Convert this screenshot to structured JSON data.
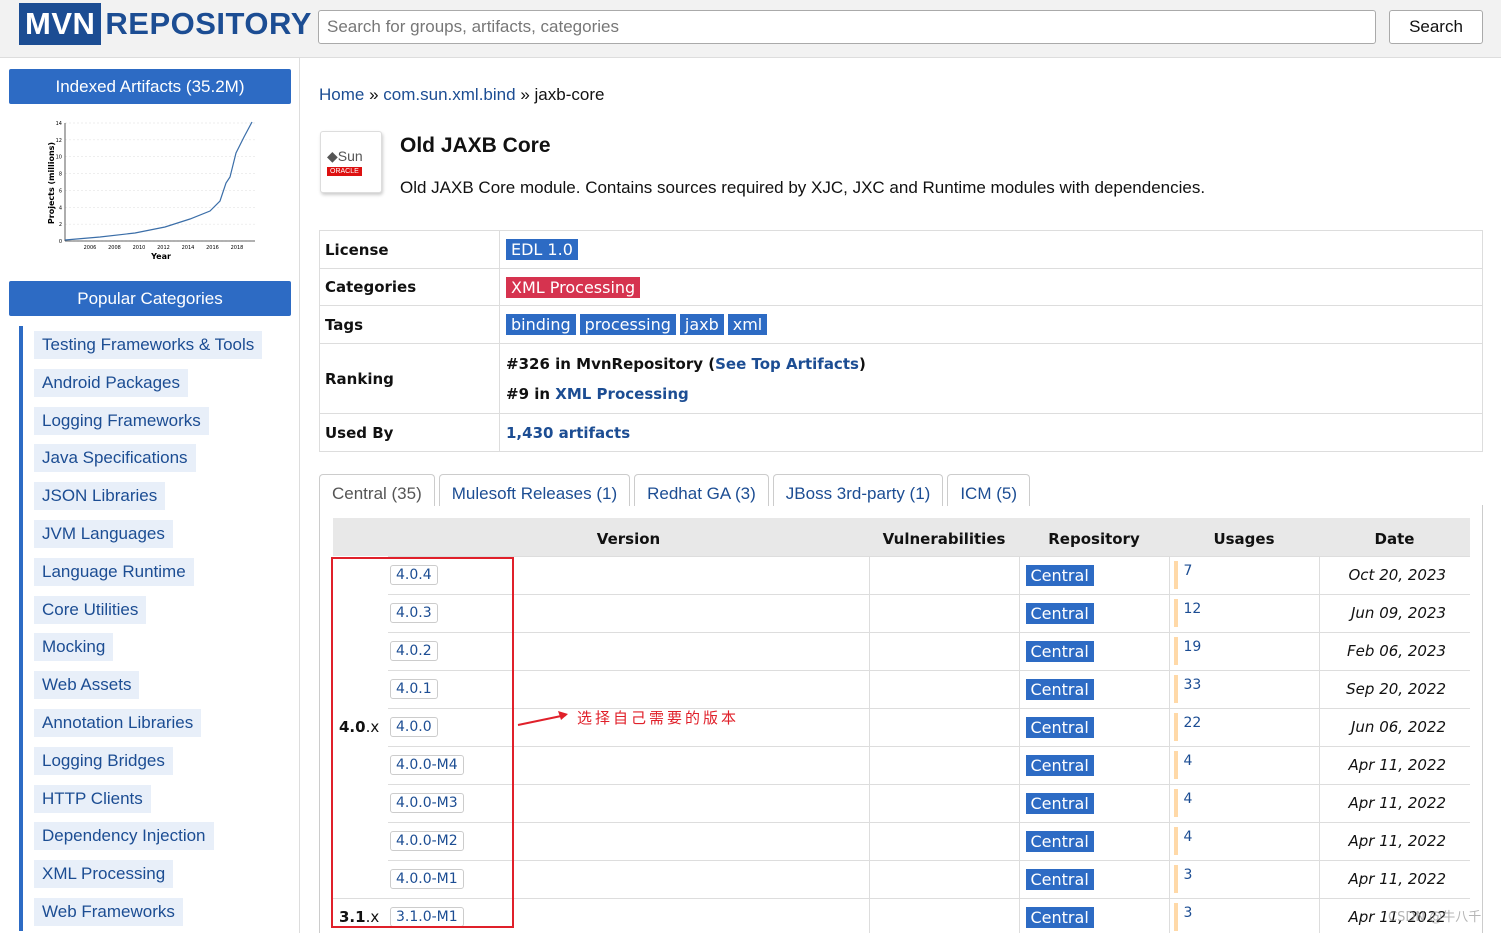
{
  "header": {
    "logo_mvn": "MVN",
    "logo_repo": "REPOSITORY",
    "search_placeholder": "Search for groups, artifacts, categories",
    "search_button": "Search"
  },
  "sidebar": {
    "indexed_title": "Indexed Artifacts (35.2M)",
    "chart": {
      "ylabel": "Projects (millions)",
      "xlabel": "Year",
      "yticks": [
        "0",
        "2",
        "4",
        "6",
        "8",
        "10",
        "12",
        "14"
      ],
      "xticks": [
        "2006",
        "2008",
        "2010",
        "2012",
        "2014",
        "2016",
        "2018"
      ]
    },
    "popular_title": "Popular Categories",
    "categories": [
      "Testing Frameworks & Tools",
      "Android Packages",
      "Logging Frameworks",
      "Java Specifications",
      "JSON Libraries",
      "JVM Languages",
      "Language Runtime",
      "Core Utilities",
      "Mocking",
      "Web Assets",
      "Annotation Libraries",
      "Logging Bridges",
      "HTTP Clients",
      "Dependency Injection",
      "XML Processing",
      "Web Frameworks"
    ]
  },
  "breadcrumb": {
    "home": "Home",
    "sep": "»",
    "group": "com.sun.xml.bind",
    "artifact": "jaxb-core"
  },
  "artifact": {
    "logo_text": "Sun",
    "logo_sub": "ORACLE",
    "title": "Old JAXB Core",
    "description": "Old JAXB Core module. Contains sources required by XJC, JXC and Runtime modules with dependencies."
  },
  "info": {
    "license_label": "License",
    "license": "EDL 1.0",
    "categories_label": "Categories",
    "category": "XML Processing",
    "tags_label": "Tags",
    "tags": [
      "binding",
      "processing",
      "jaxb",
      "xml"
    ],
    "ranking_label": "Ranking",
    "rank1_prefix": "#326 in MvnRepository (",
    "rank1_link": "See Top Artifacts",
    "rank1_suffix": ")",
    "rank2_prefix": "#9 in ",
    "rank2_link": "XML Processing",
    "usedby_label": "Used By",
    "usedby": "1,430 artifacts"
  },
  "tabs": [
    "Central (35)",
    "Mulesoft Releases (1)",
    "Redhat GA (3)",
    "JBoss 3rd-party (1)",
    "ICM (5)"
  ],
  "versions_table": {
    "headers": [
      "Version",
      "Vulnerabilities",
      "Repository",
      "Usages",
      "Date"
    ],
    "groups": [
      {
        "name": "4.0",
        "suffix": ".x"
      },
      {
        "name": "3.1",
        "suffix": ".x"
      }
    ],
    "rows": [
      {
        "version": "4.0.4",
        "repo": "Central",
        "usages": "7",
        "date": "Oct 20, 2023"
      },
      {
        "version": "4.0.3",
        "repo": "Central",
        "usages": "12",
        "date": "Jun 09, 2023"
      },
      {
        "version": "4.0.2",
        "repo": "Central",
        "usages": "19",
        "date": "Feb 06, 2023"
      },
      {
        "version": "4.0.1",
        "repo": "Central",
        "usages": "33",
        "date": "Sep 20, 2022"
      },
      {
        "version": "4.0.0",
        "repo": "Central",
        "usages": "22",
        "date": "Jun 06, 2022"
      },
      {
        "version": "4.0.0-M4",
        "repo": "Central",
        "usages": "4",
        "date": "Apr 11, 2022"
      },
      {
        "version": "4.0.0-M3",
        "repo": "Central",
        "usages": "4",
        "date": "Apr 11, 2022"
      },
      {
        "version": "4.0.0-M2",
        "repo": "Central",
        "usages": "4",
        "date": "Apr 11, 2022"
      },
      {
        "version": "4.0.0-M1",
        "repo": "Central",
        "usages": "3",
        "date": "Apr 11, 2022"
      },
      {
        "version": "3.1.0-M1",
        "repo": "Central",
        "usages": "3",
        "date": "Apr 11, 2022"
      }
    ]
  },
  "annotation": {
    "text": "选择自己需要的版本",
    "color": "#e0202a"
  },
  "watermark": "CSDN @牛八千"
}
